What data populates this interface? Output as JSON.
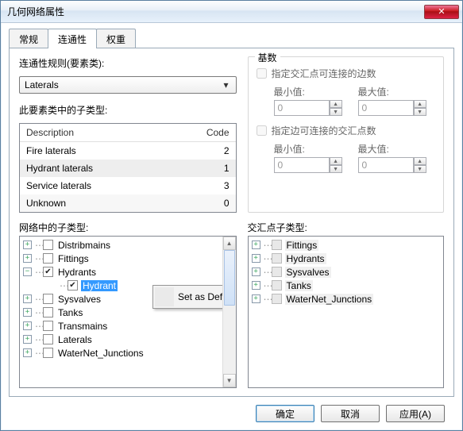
{
  "window": {
    "title": "几何网络属性"
  },
  "tabs": {
    "general": "常规",
    "connectivity": "连通性",
    "weight": "权重"
  },
  "rulesLabel": "连通性规则(要素类):",
  "featureClass": "Laterals",
  "subtypesLabel": "此要素类中的子类型:",
  "gridHeaders": {
    "description": "Description",
    "code": "Code"
  },
  "subtypeRows": [
    {
      "desc": "Fire laterals",
      "code": "2"
    },
    {
      "desc": "Hydrant laterals",
      "code": "1"
    },
    {
      "desc": "Service laterals",
      "code": "3"
    },
    {
      "desc": "Unknown",
      "code": "0"
    }
  ],
  "cardinality": {
    "legend": "基数",
    "edgesChk": "指定交汇点可连接的边数",
    "junctionsChk": "指定边可连接的交汇点数",
    "minLabel": "最小值:",
    "maxLabel": "最大值:",
    "edgesMin": "0",
    "edgesMax": "0",
    "juncMin": "0",
    "juncMax": "0"
  },
  "netSubtypesLabel": "网络中的子类型:",
  "junctionSubtypesLabel": "交汇点子类型:",
  "netTree": {
    "items": {
      "distribmains": "Distribmains",
      "fittings": "Fittings",
      "hydrants": "Hydrants",
      "hydrant": "Hydrant",
      "sysvalves": "Sysvalves",
      "tanks": "Tanks",
      "transmains": "Transmains",
      "laterals": "Laterals",
      "waternet": "WaterNet_Junctions"
    }
  },
  "juncTree": {
    "items": {
      "fittings": "Fittings",
      "hydrants": "Hydrants",
      "sysvalves": "Sysvalves",
      "tanks": "Tanks",
      "waternet": "WaterNet_Junctions"
    }
  },
  "contextMenu": {
    "setDefault": "Set as Default"
  },
  "buttons": {
    "ok": "确定",
    "cancel": "取消",
    "apply": "应用(A)"
  }
}
